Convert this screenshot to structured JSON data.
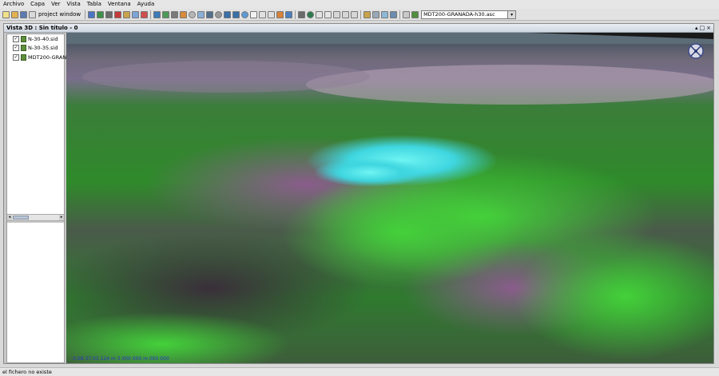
{
  "menu": [
    "Archivo",
    "Capa",
    "Ver",
    "Vista",
    "Tabla",
    "Ventana",
    "Ayuda"
  ],
  "menu_mnemonics": [
    "A",
    "C",
    "V",
    "V",
    "T",
    "V",
    "A"
  ],
  "toolbar": {
    "project_window_label": "project window",
    "layer_combo_value": "MDT200-GRANADA-h30.asc",
    "combo_arrow": "▾"
  },
  "view": {
    "title": "Vista 3D : Sin título - 0",
    "controls": [
      "▴",
      "□",
      "×"
    ]
  },
  "toc": {
    "layers": [
      {
        "name": "N-30-40.sid",
        "checked": "✓"
      },
      {
        "name": "N-30-35.sid",
        "checked": "✓"
      },
      {
        "name": "MDT200-GRAN",
        "checked": "✓"
      }
    ]
  },
  "map": {
    "coordinates": "-3.09 37.03 124 m 3 000 000 m 000 000"
  },
  "status": {
    "message": "el fichero no existe"
  },
  "colors": {
    "accent_cyan": "#3fe3e6",
    "coord_text": "#2a36c9"
  }
}
